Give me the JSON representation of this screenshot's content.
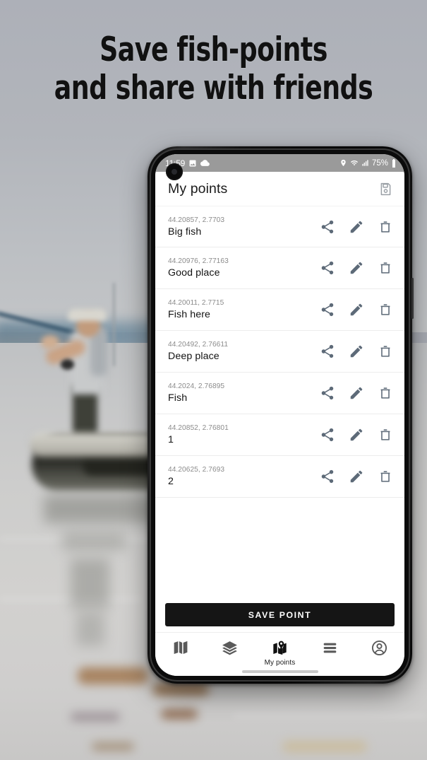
{
  "headline": {
    "line1": "Save fish-points",
    "line2": "and share with friends"
  },
  "statusbar": {
    "time": "11:59",
    "battery_percent": "75%",
    "icons": [
      "image-icon",
      "cloud-icon",
      "location-pin-icon",
      "wifi-icon",
      "signal-bars-icon",
      "battery-icon"
    ]
  },
  "header": {
    "title": "My points",
    "save_icon": "floppy-disk-icon"
  },
  "list": {
    "row_actions": {
      "share_label": "share-icon",
      "edit_label": "pencil-icon",
      "delete_label": "trash-icon"
    },
    "items": [
      {
        "coords": "44.20857, 2.7703",
        "name": "Big fish"
      },
      {
        "coords": "44.20976, 2.77163",
        "name": "Good place"
      },
      {
        "coords": "44.20011, 2.7715",
        "name": "Fish here"
      },
      {
        "coords": "44.20492, 2.76611",
        "name": "Deep place"
      },
      {
        "coords": "44.2024, 2.76895",
        "name": "Fish"
      },
      {
        "coords": "44.20852, 2.76801",
        "name": "1"
      },
      {
        "coords": "44.20625, 2.7693",
        "name": "2"
      }
    ]
  },
  "actions": {
    "save_point_label": "SAVE POINT"
  },
  "bottom_nav": {
    "items": [
      {
        "icon": "map-icon",
        "label": "",
        "active": false
      },
      {
        "icon": "layers-icon",
        "label": "",
        "active": false
      },
      {
        "icon": "map-pin-icon",
        "label": "My points",
        "active": true
      },
      {
        "icon": "list-menu-icon",
        "label": "",
        "active": false
      },
      {
        "icon": "account-icon",
        "label": "",
        "active": false
      }
    ]
  },
  "colors": {
    "accent_dark": "#151515",
    "icon_gray": "#5d6a78",
    "muted_text": "#8b8b8b",
    "statusbar_bg": "#9a9a9a",
    "background_sky": "#adb0b8",
    "background_water": "#cdcdcc"
  }
}
